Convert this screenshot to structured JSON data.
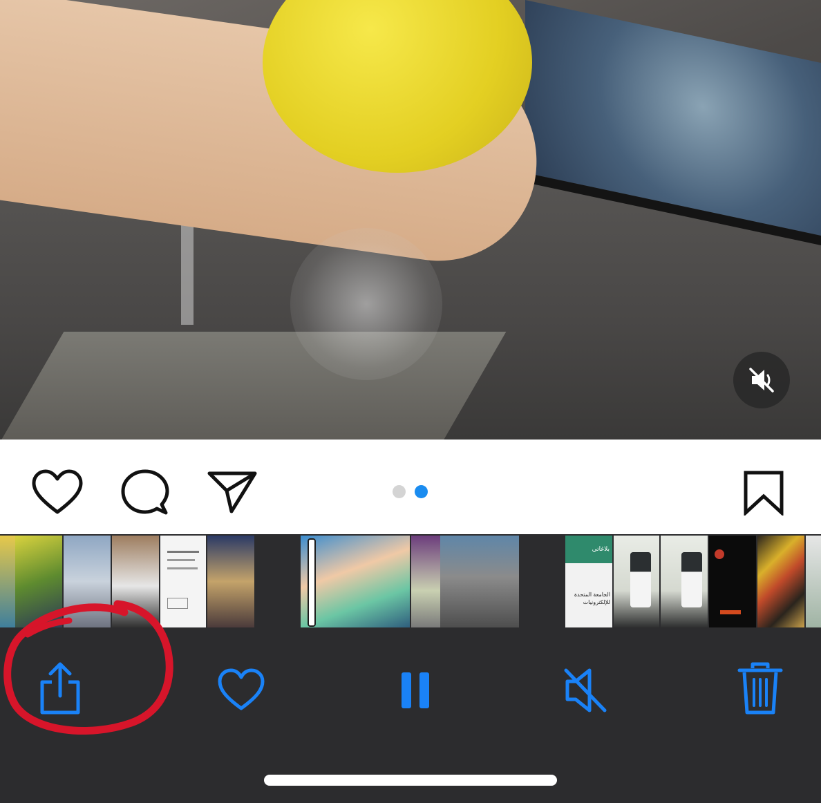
{
  "media": {
    "video_description_icon": "video-frame",
    "mute_badge_icon": "speaker-muted-icon"
  },
  "post_actions": {
    "like_icon": "heart-outline-icon",
    "comment_icon": "comment-bubble-icon",
    "share_icon": "paper-plane-icon",
    "save_icon": "bookmark-outline-icon",
    "carousel": {
      "count": 2,
      "active_index": 2
    }
  },
  "thumbnails": {
    "group1": [
      "thumb-1",
      "thumb-2",
      "thumb-3",
      "thumb-4",
      "thumb-5",
      "thumb-6"
    ],
    "group2": [
      "thumb-7",
      "thumb-8-current",
      "thumb-9"
    ],
    "group3": [
      "thumb-10",
      "thumb-11",
      "thumb-12",
      "thumb-13",
      "thumb-14",
      "thumb-15"
    ],
    "text_thumb_label": "بلاغاتي",
    "text_thumb_body": "الجامعة المتحدة للإلكترونيات"
  },
  "toolbar": {
    "share_icon": "share-square-arrow-icon",
    "favorite_icon": "heart-outline-icon",
    "pause_icon": "pause-icon",
    "mute_icon": "speaker-slash-icon",
    "delete_icon": "trash-icon"
  },
  "colors": {
    "accent": "#1a82f7",
    "toolbar_bg": "#2c2c2e",
    "dot_active": "#1a8cf0",
    "dot_inactive": "#d4d4d4",
    "annotation": "#d7152a"
  }
}
